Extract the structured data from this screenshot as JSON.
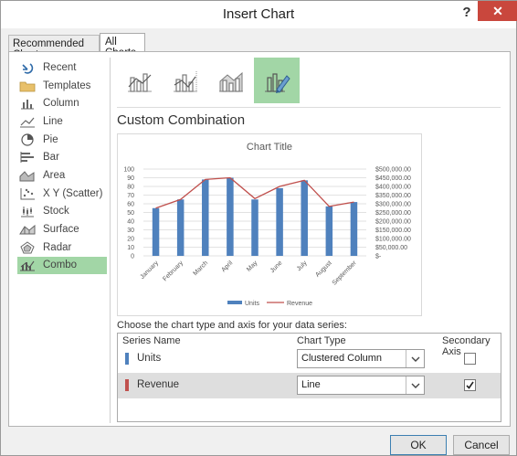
{
  "dialog": {
    "title": "Insert Chart",
    "help_label": "?",
    "close_label": "✕",
    "ok_label": "OK",
    "cancel_label": "Cancel"
  },
  "tabs": [
    "Recommended Charts",
    "All Charts"
  ],
  "sidebar": {
    "items": [
      {
        "label": "Recent",
        "icon": "recent-icon"
      },
      {
        "label": "Templates",
        "icon": "folder-icon"
      },
      {
        "label": "Column",
        "icon": "column-chart-icon"
      },
      {
        "label": "Line",
        "icon": "line-chart-icon"
      },
      {
        "label": "Pie",
        "icon": "pie-chart-icon"
      },
      {
        "label": "Bar",
        "icon": "bar-chart-icon"
      },
      {
        "label": "Area",
        "icon": "area-chart-icon"
      },
      {
        "label": "X Y (Scatter)",
        "icon": "scatter-chart-icon"
      },
      {
        "label": "Stock",
        "icon": "stock-chart-icon"
      },
      {
        "label": "Surface",
        "icon": "surface-chart-icon"
      },
      {
        "label": "Radar",
        "icon": "radar-chart-icon"
      },
      {
        "label": "Combo",
        "icon": "combo-chart-icon",
        "selected": true
      }
    ]
  },
  "section_title": "Custom Combination",
  "choose_label": "Choose the chart type and axis for your data series:",
  "table": {
    "headers": [
      "Series Name",
      "Chart Type",
      "Secondary Axis"
    ],
    "rows": [
      {
        "name": "Units",
        "color": "#4f81bd",
        "chart_type": "Clustered Column",
        "secondary": false
      },
      {
        "name": "Revenue",
        "color": "#c0504d",
        "chart_type": "Line",
        "secondary": true
      }
    ]
  },
  "colors": {
    "accent_selected": "#a2d6a6",
    "units": "#4f81bd",
    "revenue": "#c0504d",
    "close": "#c9473d"
  },
  "chart_data": {
    "type": "bar",
    "title": "Chart Title",
    "categories": [
      "January",
      "February",
      "March",
      "April",
      "May",
      "June",
      "July",
      "August",
      "September"
    ],
    "series": [
      {
        "name": "Units",
        "type": "column",
        "axis": "primary",
        "values": [
          55,
          65,
          88,
          90,
          65,
          78,
          87,
          57,
          62
        ]
      },
      {
        "name": "Revenue",
        "type": "line",
        "axis": "secondary",
        "values": [
          275000,
          325000,
          440000,
          450000,
          330000,
          400000,
          435000,
          285000,
          310000
        ]
      }
    ],
    "y_ticks": [
      "0",
      "10",
      "20",
      "30",
      "40",
      "50",
      "60",
      "70",
      "80",
      "90",
      "100"
    ],
    "y2_ticks": [
      "$-",
      "$50,000.00",
      "$100,000.00",
      "$150,000.00",
      "$200,000.00",
      "$250,000.00",
      "$300,000.00",
      "$350,000.00",
      "$400,000.00",
      "$450,000.00",
      "$500,000.00"
    ],
    "ylim": [
      0,
      100
    ],
    "y2lim": [
      0,
      500000
    ],
    "grid": true,
    "legend_placement": "bottom"
  }
}
